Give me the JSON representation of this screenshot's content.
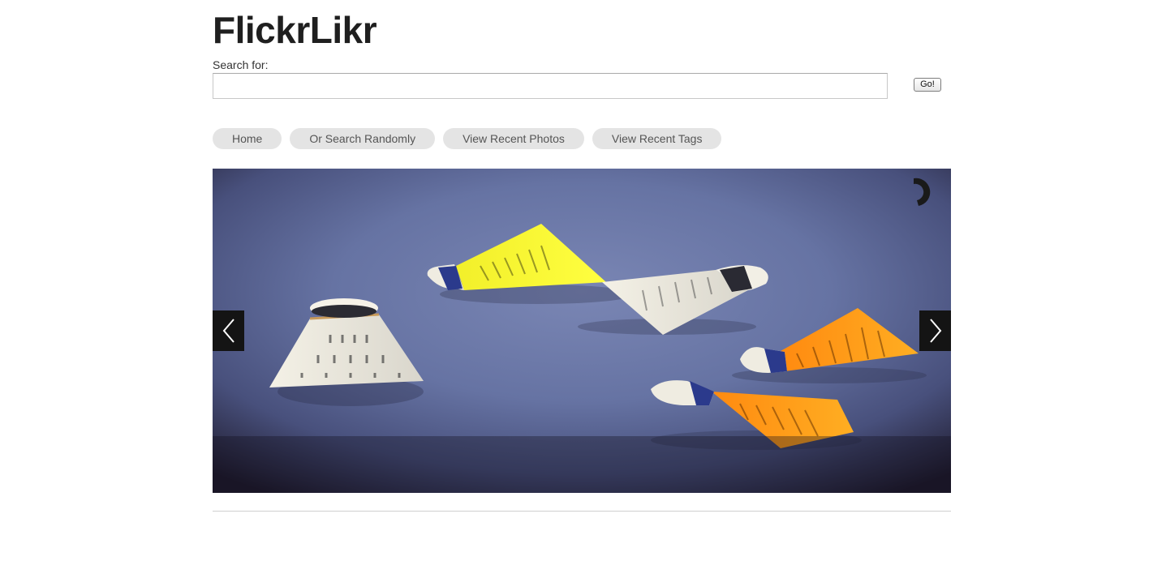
{
  "header": {
    "title": "FlickrLikr"
  },
  "search": {
    "label": "Search for:",
    "value": "",
    "placeholder": "",
    "go_label": "Go!"
  },
  "nav": {
    "items": [
      {
        "label": "Home"
      },
      {
        "label": "Or Search Randomly"
      },
      {
        "label": "View Recent Photos"
      },
      {
        "label": "View Recent Tags"
      }
    ]
  },
  "slider": {
    "photo_subject": "shuttlecocks-photo",
    "prev_icon": "chevron-left-icon",
    "next_icon": "chevron-right-icon",
    "loader_icon": "loading-spinner-icon"
  },
  "colors": {
    "nav_bg": "#e4e4e4",
    "nav_text": "#555555",
    "arrow_bg": "#141414",
    "divider": "#cfcfcf"
  }
}
